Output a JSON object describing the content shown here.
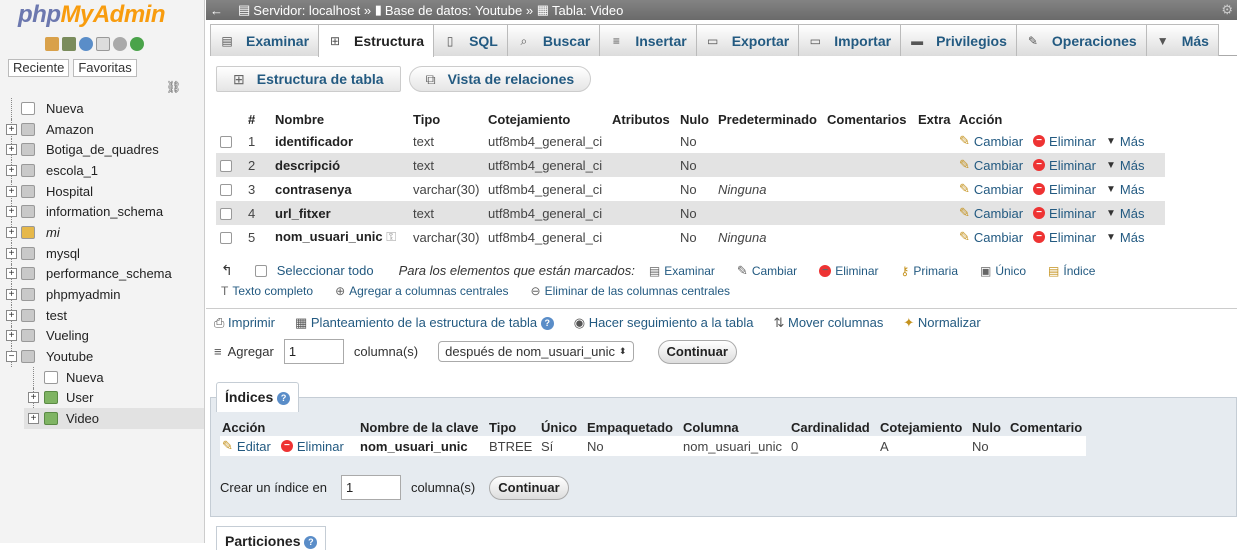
{
  "logo": {
    "php": "php",
    "myadmin": "MyAdmin"
  },
  "sidebar": {
    "tabs": [
      "Reciente",
      "Favoritas"
    ],
    "databases": [
      {
        "name": "Nueva",
        "italic": false
      },
      {
        "name": "Amazon",
        "italic": false
      },
      {
        "name": "Botiga_de_quadres",
        "italic": false
      },
      {
        "name": "escola_1",
        "italic": false
      },
      {
        "name": "Hospital",
        "italic": false
      },
      {
        "name": "information_schema",
        "italic": false
      },
      {
        "name": "mi",
        "italic": true
      },
      {
        "name": "mysql",
        "italic": false
      },
      {
        "name": "performance_schema",
        "italic": false
      },
      {
        "name": "phpmyadmin",
        "italic": false
      },
      {
        "name": "test",
        "italic": false
      },
      {
        "name": "Vueling",
        "italic": false
      },
      {
        "name": "Youtube",
        "italic": false
      }
    ],
    "youtube_children": [
      "Nueva",
      "User",
      "Video"
    ]
  },
  "breadcrumb": {
    "server": "Servidor: localhost",
    "sep": "»",
    "database": "Base de datos: Youtube",
    "table": "Tabla: Video"
  },
  "tabs": [
    "Examinar",
    "Estructura",
    "SQL",
    "Buscar",
    "Insertar",
    "Exportar",
    "Importar",
    "Privilegios",
    "Operaciones",
    "Más"
  ],
  "subtabs": {
    "structure": "Estructura de tabla",
    "relations": "Vista de relaciones"
  },
  "columns_table": {
    "headers": [
      "#",
      "Nombre",
      "Tipo",
      "Cotejamiento",
      "Atributos",
      "Nulo",
      "Predeterminado",
      "Comentarios",
      "Extra",
      "Acción"
    ],
    "rows": [
      {
        "num": "1",
        "name": "identificador",
        "type": "text",
        "collation": "utf8mb4_general_ci",
        "null": "No",
        "default": ""
      },
      {
        "num": "2",
        "name": "descripció",
        "type": "text",
        "collation": "utf8mb4_general_ci",
        "null": "No",
        "default": ""
      },
      {
        "num": "3",
        "name": "contrasenya",
        "type": "varchar(30)",
        "collation": "utf8mb4_general_ci",
        "null": "No",
        "default": "Ninguna"
      },
      {
        "num": "4",
        "name": "url_fitxer",
        "type": "text",
        "collation": "utf8mb4_general_ci",
        "null": "No",
        "default": ""
      },
      {
        "num": "5",
        "name": "nom_usuari_unic",
        "type": "varchar(30)",
        "collation": "utf8mb4_general_ci",
        "null": "No",
        "default": "Ninguna"
      }
    ],
    "actions": {
      "change": "Cambiar",
      "drop": "Eliminar",
      "more": "Más"
    }
  },
  "selection": {
    "select_all": "Seleccionar todo",
    "with_selected": "Para los elementos que están marcados:",
    "browse": "Examinar",
    "change": "Cambiar",
    "drop": "Eliminar",
    "primary": "Primaria",
    "unique": "Único",
    "index": "Índice",
    "fulltext": "Texto completo",
    "add_central": "Agregar a columnas centrales",
    "remove_central": "Eliminar de las columnas centrales"
  },
  "tools": {
    "print": "Imprimir",
    "propose": "Planteamiento de la estructura de tabla",
    "track": "Hacer seguimiento a la tabla",
    "move": "Mover columnas",
    "normalize": "Normalizar"
  },
  "add_columns": {
    "label": "Agregar",
    "value": "1",
    "unit": "columna(s)",
    "position": "después de nom_usuari_unic",
    "go": "Continuar"
  },
  "indexes": {
    "title": "Índices",
    "headers": [
      "Acción",
      "Nombre de la clave",
      "Tipo",
      "Único",
      "Empaquetado",
      "Columna",
      "Cardinalidad",
      "Cotejamiento",
      "Nulo",
      "Comentario"
    ],
    "row": {
      "edit": "Editar",
      "drop": "Eliminar",
      "key": "nom_usuari_unic",
      "type": "BTREE",
      "unique": "Sí",
      "packed": "No",
      "column": "nom_usuari_unic",
      "cardinality": "0",
      "collation": "A",
      "null": "No",
      "comment": ""
    },
    "create_label": "Crear un índice en",
    "create_value": "1",
    "create_unit": "columna(s)",
    "go": "Continuar"
  },
  "partitions": {
    "title": "Particiones"
  }
}
